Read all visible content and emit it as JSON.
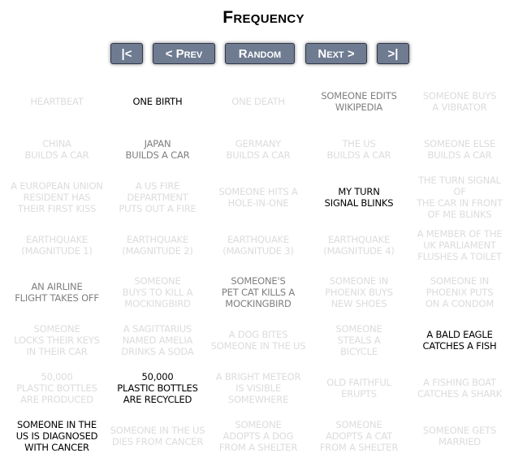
{
  "title": "Frequency",
  "nav": {
    "first": "|<",
    "prev": "< Prev",
    "random": "Random",
    "next": "Next >",
    "last": ">|"
  },
  "grid": [
    {
      "text": "HEARTBEAT",
      "shade": "faint"
    },
    {
      "text": "ONE BIRTH",
      "shade": "dark"
    },
    {
      "text": "ONE DEATH",
      "shade": "faint"
    },
    {
      "text": "SOMEONE EDITS\nWIKIPEDIA",
      "shade": "medium"
    },
    {
      "text": "SOMEONE BUYS\nA VIBRATOR",
      "shade": "faint"
    },
    {
      "text": "CHINA\nBUILDS A CAR",
      "shade": "faint"
    },
    {
      "text": "JAPAN\nBUILDS A CAR",
      "shade": "medium"
    },
    {
      "text": "GERMANY\nBUILDS A CAR",
      "shade": "faint"
    },
    {
      "text": "THE US\nBUILDS A CAR",
      "shade": "faint"
    },
    {
      "text": "SOMEONE ELSE\nBUILDS A CAR",
      "shade": "faint"
    },
    {
      "text": "A EUROPEAN UNION\nRESIDENT HAS\nTHEIR FIRST KISS",
      "shade": "faint"
    },
    {
      "text": "A US FIRE\nDEPARTMENT\nPUTS OUT A FIRE",
      "shade": "faint"
    },
    {
      "text": "SOMEONE HITS A\nHOLE-IN-ONE",
      "shade": "faint"
    },
    {
      "text": "MY TURN\nSIGNAL BLINKS",
      "shade": "dark"
    },
    {
      "text": "THE TURN SIGNAL OF\nTHE CAR IN FRONT\nOF ME BLINKS",
      "shade": "faint"
    },
    {
      "text": "EARTHQUAKE\n(MAGNITUDE 1)",
      "shade": "faint"
    },
    {
      "text": "EARTHQUAKE\n(MAGNITUDE 2)",
      "shade": "faint"
    },
    {
      "text": "EARTHQUAKE\n(MAGNITUDE 3)",
      "shade": "faint"
    },
    {
      "text": "EARTHQUAKE\n(MAGNITUDE 4)",
      "shade": "faint"
    },
    {
      "text": "A MEMBER OF THE\nUK PARLIAMENT\nFLUSHES A TOILET",
      "shade": "faint"
    },
    {
      "text": "AN AIRLINE\nFLIGHT TAKES OFF",
      "shade": "medium"
    },
    {
      "text": "SOMEONE\nBUYS TO KILL A\nMOCKINGBIRD",
      "shade": "faint"
    },
    {
      "text": "SOMEONE'S\nPET CAT KILLS A\nMOCKINGBIRD",
      "shade": "medium"
    },
    {
      "text": "SOMEONE IN\nPHOENIX BUYS\nNEW SHOES",
      "shade": "faint"
    },
    {
      "text": "SOMEONE IN\nPHOENIX PUTS\nON A CONDOM",
      "shade": "faint"
    },
    {
      "text": "SOMEONE\nLOCKS THEIR KEYS\nIN THEIR CAR",
      "shade": "faint"
    },
    {
      "text": "A SAGITTARIUS\nNAMED AMELIA\nDRINKS A SODA",
      "shade": "faint"
    },
    {
      "text": "A DOG BITES\nSOMEONE IN THE US",
      "shade": "faint"
    },
    {
      "text": "SOMEONE\nSTEALS A\nBICYCLE",
      "shade": "faint"
    },
    {
      "text": "A BALD EAGLE\nCATCHES A FISH",
      "shade": "dark"
    },
    {
      "text": "50,000\nPLASTIC BOTTLES\nARE PRODUCED",
      "shade": "faint"
    },
    {
      "text": "50,000\nPLASTIC BOTTLES\nARE RECYCLED",
      "shade": "dark"
    },
    {
      "text": "A BRIGHT METEOR\nIS VISIBLE\nSOMEWHERE",
      "shade": "faint"
    },
    {
      "text": "OLD FAITHFUL\nERUPTS",
      "shade": "faint"
    },
    {
      "text": "A FISHING BOAT\nCATCHES A SHARK",
      "shade": "faint"
    },
    {
      "text": "SOMEONE IN THE\nUS IS DIAGNOSED\nWITH CANCER",
      "shade": "dark"
    },
    {
      "text": "SOMEONE IN THE US\nDIES FROM CANCER",
      "shade": "faint"
    },
    {
      "text": "SOMEONE\nADOPTS A DOG\nFROM A SHELTER",
      "shade": "faint"
    },
    {
      "text": "SOMEONE\nADOPTS A CAT\nFROM A SHELTER",
      "shade": "faint"
    },
    {
      "text": "SOMEONE GETS\nMARRIED",
      "shade": "faint"
    }
  ]
}
